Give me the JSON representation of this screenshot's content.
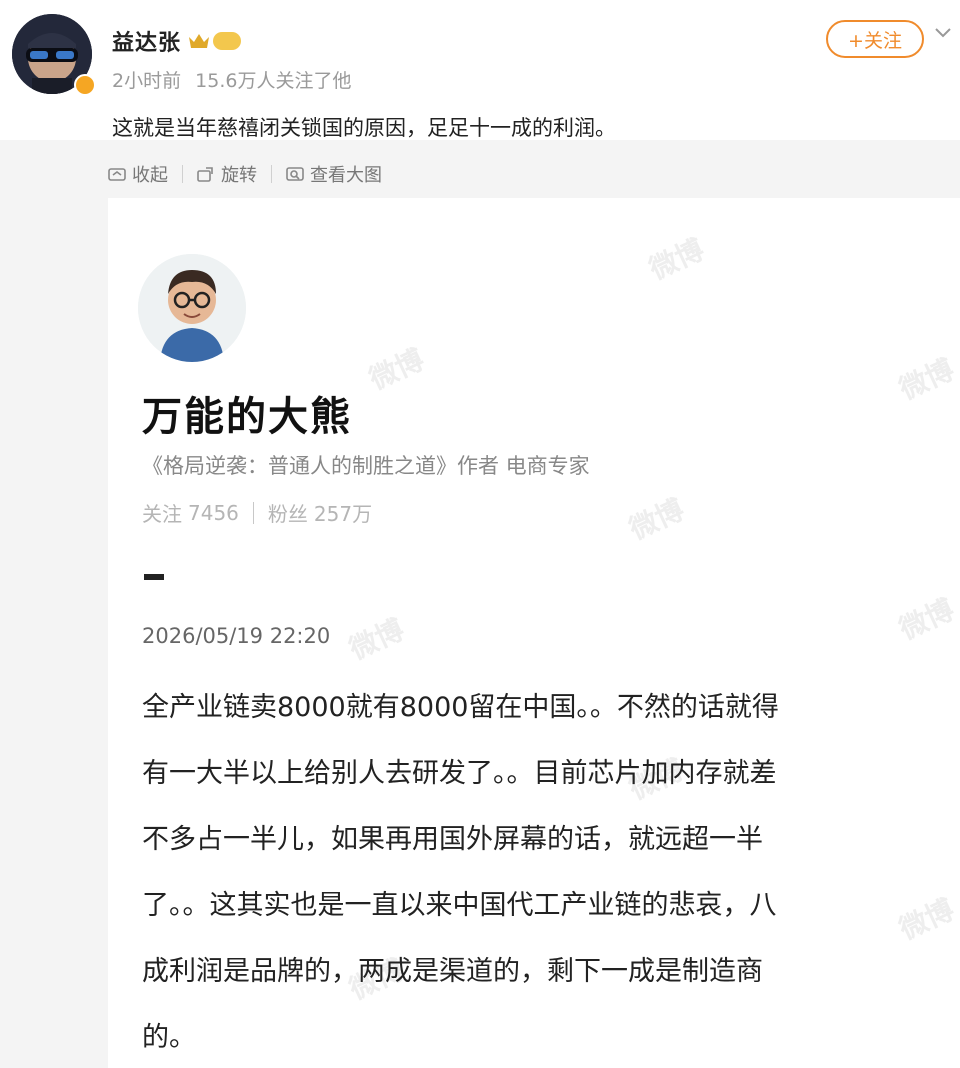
{
  "post": {
    "username": "益达张",
    "time": "2小时前",
    "followers_note": "15.6万人关注了他",
    "follow_label": "+关注",
    "text": "这就是当年慈禧闭关锁国的原因，足足十一成的利润。",
    "accent_color": "#f08b2c"
  },
  "toolbar": {
    "collapse_label": "收起",
    "rotate_label": "旋转",
    "view_full_label": "查看大图"
  },
  "card": {
    "author_name": "万能的大熊",
    "author_bio": "《格局逆袭：普通人的制胜之道》作者 电商专家",
    "following_label": "关注",
    "following_count": "7456",
    "fans_label": "粉丝",
    "fans_count": "257万",
    "date": "2026/05/19 22:20",
    "watermark": "微博",
    "body_lines": [
      "全产业链卖8000就有8000留在中国。。不然的话就得",
      "有一大半以上给别人去研发了。。目前芯片加内存就差",
      "不多占一半儿，如果再用国外屏幕的话，就远超一半",
      "了。。这其实也是一直以来中国代工产业链的悲哀，八",
      "成利润是品牌的，两成是渠道的，剩下一成是制造商",
      "的。"
    ]
  }
}
